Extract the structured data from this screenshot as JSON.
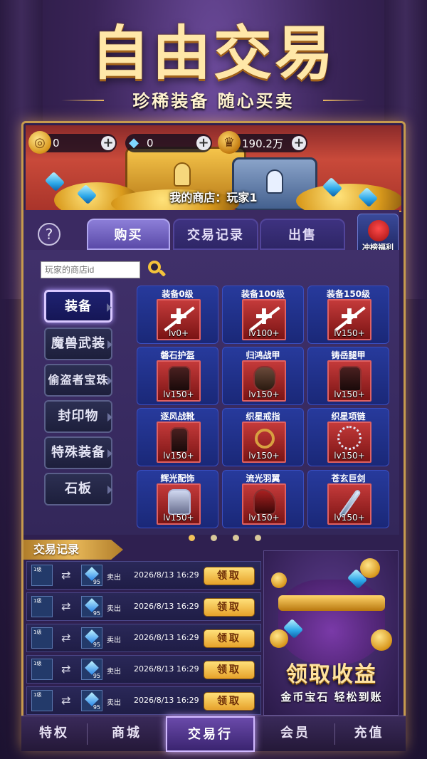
{
  "hero": {
    "title": "自由交易",
    "subtitle": "珍稀装备 随心买卖"
  },
  "resources": {
    "coins": "0",
    "gems": "0",
    "crowns": "190.2万"
  },
  "shop_name": "我的商店：玩家1",
  "tabs": [
    "购买",
    "交易记录",
    "出售"
  ],
  "rank_button": "冲榜福利",
  "search": {
    "placeholder": "玩家的商店id"
  },
  "categories": [
    "装备",
    "魔兽武装",
    "偷盗者宝珠",
    "封印物",
    "特殊装备",
    "石板"
  ],
  "items": [
    {
      "name": "装备0级",
      "level": "lv0+"
    },
    {
      "name": "装备100级",
      "level": "lv100+"
    },
    {
      "name": "装备150级",
      "level": "lv150+"
    },
    {
      "name": "磐石护盔",
      "level": "lv150+"
    },
    {
      "name": "归鸿战甲",
      "level": "lv150+"
    },
    {
      "name": "铸岳腿甲",
      "level": "lv150+"
    },
    {
      "name": "逐风战靴",
      "level": "lv150+"
    },
    {
      "name": "织星戒指",
      "level": "lv150+"
    },
    {
      "name": "织星项链",
      "level": "lv150+"
    },
    {
      "name": "辉光配饰",
      "level": "lv150+"
    },
    {
      "name": "流光羽翼",
      "level": "lv150+"
    },
    {
      "name": "苍玄巨剑",
      "level": "lv150+"
    }
  ],
  "records_title": "交易记录",
  "records": [
    {
      "item_level": "1级",
      "qty": "95",
      "action": "卖出",
      "time": "2026/8/13 16:29",
      "button": "领取"
    },
    {
      "item_level": "1级",
      "qty": "95",
      "action": "卖出",
      "time": "2026/8/13 16:29",
      "button": "领取"
    },
    {
      "item_level": "1级",
      "qty": "95",
      "action": "卖出",
      "time": "2026/8/13 16:29",
      "button": "领取"
    },
    {
      "item_level": "1级",
      "qty": "95",
      "action": "卖出",
      "time": "2026/8/13 16:29",
      "button": "领取"
    },
    {
      "item_level": "1级",
      "qty": "95",
      "action": "卖出",
      "time": "2026/8/13 16:29",
      "button": "领取"
    }
  ],
  "promo": {
    "title": "领取收益",
    "subtitle": "金币宝石 轻松到账"
  },
  "bottom_nav": [
    "特权",
    "商城",
    "交易行",
    "会员",
    "充值"
  ]
}
